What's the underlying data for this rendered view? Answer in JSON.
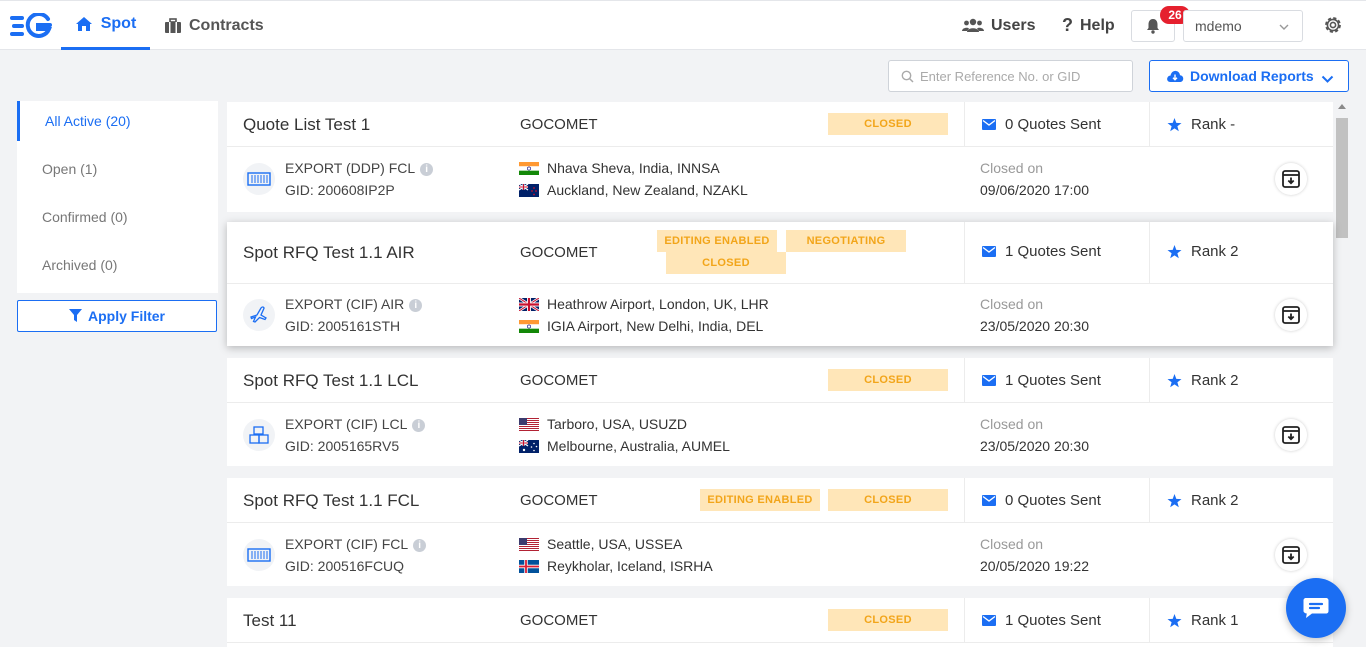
{
  "nav": {
    "tabs": [
      {
        "label": "Spot",
        "icon": "home-icon",
        "active": true
      },
      {
        "label": "Contracts",
        "icon": "briefcase-icon",
        "active": false
      }
    ],
    "users_label": "Users",
    "help_label": "Help",
    "notification_count": "26",
    "user_name": "mdemo"
  },
  "toolbar": {
    "search_placeholder": "Enter Reference No. or GID",
    "download_label": "Download Reports"
  },
  "sidebar": {
    "items": [
      {
        "label": "All Active (20)",
        "active": true
      },
      {
        "label": "Open (1)",
        "active": false
      },
      {
        "label": "Confirmed (0)",
        "active": false
      },
      {
        "label": "Archived (0)",
        "active": false
      }
    ],
    "apply_filter_label": "Apply Filter"
  },
  "colors": {
    "accent": "#1b6ef3",
    "tag_bg": "#ffe6b8",
    "tag_text": "#f2a51a",
    "badge": "#e5202e"
  },
  "cards": [
    {
      "title": "Quote List Test 1",
      "company": "GOCOMET",
      "tags": [
        "CLOSED"
      ],
      "quotes": "0 Quotes Sent",
      "rank": "Rank -",
      "mode": "EXPORT (DDP) FCL",
      "mode_icon": "container-icon",
      "gid": "GID: 200608IP2P",
      "origin": {
        "flag": "india",
        "text": "Nhava Sheva, India, INNSA"
      },
      "destination": {
        "flag": "new-zealand",
        "text": "Auckland, New Zealand, NZAKL"
      },
      "closed_label": "Closed on",
      "closed_date": "09/06/2020 17:00"
    },
    {
      "title": "Spot RFQ Test 1.1 AIR",
      "company": "GOCOMET",
      "tags": [
        "EDITING ENABLED",
        "NEGOTIATING",
        "CLOSED"
      ],
      "quotes": "1 Quotes Sent",
      "rank": "Rank 2",
      "mode": "EXPORT (CIF) AIR",
      "mode_icon": "airplane-icon",
      "gid": "GID: 2005161STH",
      "origin": {
        "flag": "uk",
        "text": "Heathrow Airport, London, UK, LHR"
      },
      "destination": {
        "flag": "india",
        "text": "IGIA Airport, New Delhi, India, DEL"
      },
      "closed_label": "Closed on",
      "closed_date": "23/05/2020 20:30"
    },
    {
      "title": "Spot RFQ Test 1.1 LCL",
      "company": "GOCOMET",
      "tags": [
        "CLOSED"
      ],
      "quotes": "1 Quotes Sent",
      "rank": "Rank 2",
      "mode": "EXPORT (CIF) LCL",
      "mode_icon": "boxes-icon",
      "gid": "GID: 2005165RV5",
      "origin": {
        "flag": "usa",
        "text": "Tarboro, USA, USUZD"
      },
      "destination": {
        "flag": "australia",
        "text": "Melbourne, Australia, AUMEL"
      },
      "closed_label": "Closed on",
      "closed_date": "23/05/2020 20:30"
    },
    {
      "title": "Spot RFQ Test 1.1 FCL",
      "company": "GOCOMET",
      "tags": [
        "EDITING ENABLED",
        "CLOSED"
      ],
      "quotes": "0 Quotes Sent",
      "rank": "Rank 2",
      "mode": "EXPORT (CIF) FCL",
      "mode_icon": "container-icon",
      "gid": "GID: 200516FCUQ",
      "origin": {
        "flag": "usa",
        "text": "Seattle, USA, USSEA"
      },
      "destination": {
        "flag": "iceland",
        "text": "Reykholar, Iceland, ISRHA"
      },
      "closed_label": "Closed on",
      "closed_date": "20/05/2020 19:22"
    },
    {
      "title": "Test 11",
      "company": "GOCOMET",
      "tags": [
        "CLOSED"
      ],
      "quotes": "1 Quotes Sent",
      "rank": "Rank 1"
    }
  ]
}
